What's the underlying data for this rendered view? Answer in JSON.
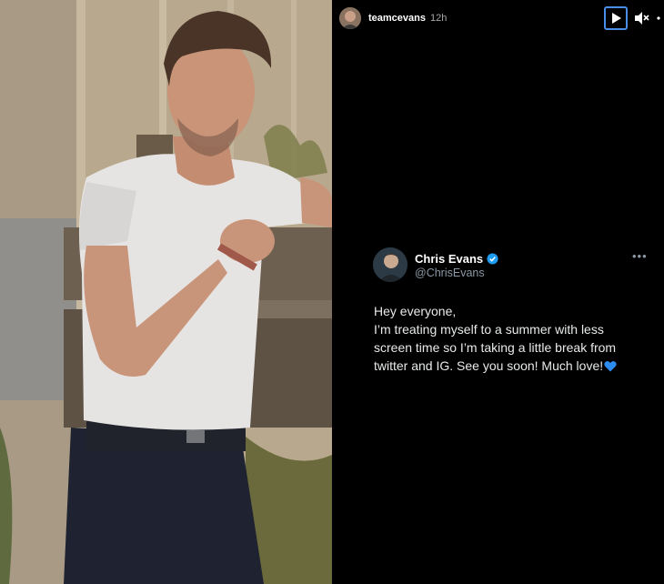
{
  "story": {
    "username": "teamcevans",
    "time": "12h",
    "controls": {
      "play_icon": "play-icon",
      "mute_icon": "muted-speaker-icon",
      "more_icon": "more-dots-icon"
    }
  },
  "tweet": {
    "name": "Chris Evans",
    "handle": "@ChrisEvans",
    "verified": true,
    "lines": [
      "Hey everyone,",
      "I’m treating myself to a summer with less",
      "screen time so I’m taking a little break from",
      "twitter and IG. See you soon! Much love!"
    ],
    "emoji": "blue-heart",
    "colors": {
      "verified": "#1d9bf0",
      "heart": "#2d8cf0",
      "accent_border": "#4a8ee8"
    }
  }
}
